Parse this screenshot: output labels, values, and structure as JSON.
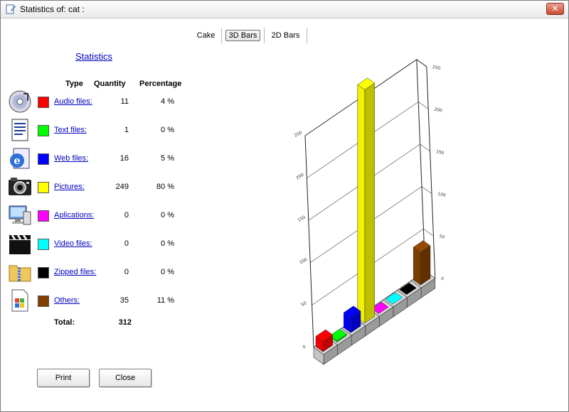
{
  "window": {
    "title": "Statistics of:  cat :",
    "close_glyph": "✕"
  },
  "tabs": [
    {
      "label": "Cake",
      "active": false
    },
    {
      "label": "3D Bars",
      "active": true
    },
    {
      "label": "2D Bars",
      "active": false
    }
  ],
  "stats": {
    "heading": "Statistics",
    "headers": {
      "type": "Type",
      "quantity": "Quantity",
      "percentage": "Percentage"
    },
    "rows": [
      {
        "icon": "audio-cd-icon",
        "color": "#ff0000",
        "type": "Audio files:",
        "quantity": "11",
        "percentage": "4 %"
      },
      {
        "icon": "text-document-icon",
        "color": "#00ff00",
        "type": "Text files:",
        "quantity": "1",
        "percentage": "0 %"
      },
      {
        "icon": "web-globe-icon",
        "color": "#0000ff",
        "type": "Web files:",
        "quantity": "16",
        "percentage": "5 %"
      },
      {
        "icon": "camera-icon",
        "color": "#ffff00",
        "type": "Pictures:",
        "quantity": "249",
        "percentage": "80 %"
      },
      {
        "icon": "application-icon",
        "color": "#ff00ff",
        "type": "Aplications:",
        "quantity": "0",
        "percentage": "0 %"
      },
      {
        "icon": "clapperboard-icon",
        "color": "#00ffff",
        "type": "Video files:",
        "quantity": "0",
        "percentage": "0 %"
      },
      {
        "icon": "zipped-folder-icon",
        "color": "#000000",
        "type": "Zipped files:",
        "quantity": "0",
        "percentage": "0 %"
      },
      {
        "icon": "windows-file-icon",
        "color": "#804000",
        "type": "Others:",
        "quantity": "35",
        "percentage": "11 %"
      }
    ],
    "total_label": "Total:",
    "total_value": "312"
  },
  "buttons": {
    "print": "Print",
    "close": "Close"
  },
  "chart_data": {
    "type": "bar",
    "style": "3d",
    "categories": [
      "Audio files",
      "Text files",
      "Web files",
      "Pictures",
      "Aplications",
      "Video files",
      "Zipped files",
      "Others"
    ],
    "values": [
      11,
      1,
      16,
      249,
      0,
      0,
      0,
      35
    ],
    "colors": [
      "#ff0000",
      "#00ff00",
      "#0000ff",
      "#ffff00",
      "#ff00ff",
      "#00ffff",
      "#000000",
      "#804000"
    ],
    "ylim": [
      0,
      250
    ],
    "right_ticks": [
      "250",
      "200",
      "150",
      "100",
      "50",
      "0"
    ],
    "left_ticks": [
      "250",
      "200",
      "150",
      "100",
      "50",
      "0"
    ],
    "grid": true
  }
}
